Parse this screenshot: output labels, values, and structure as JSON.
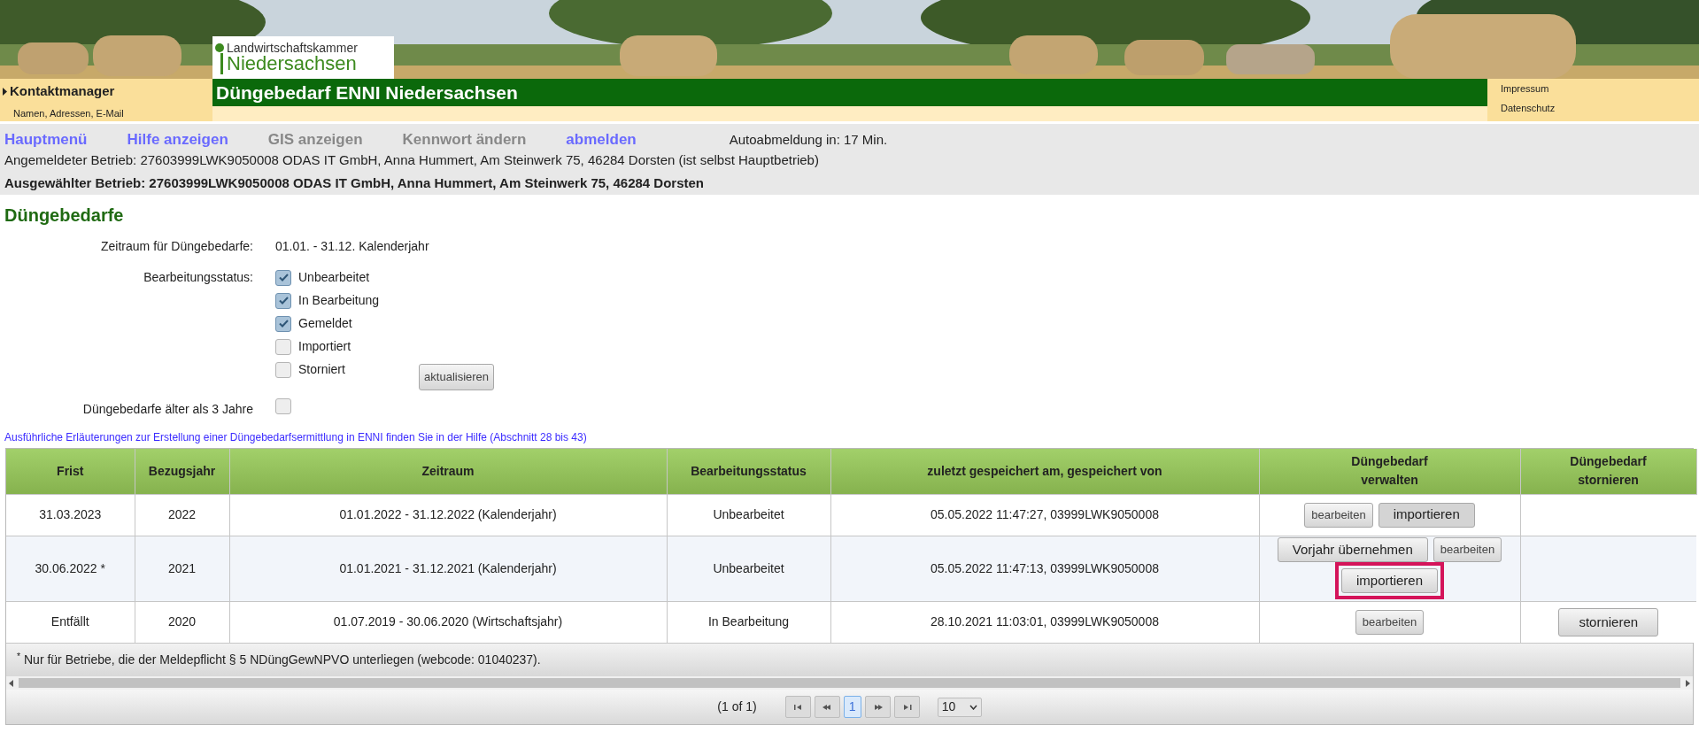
{
  "header": {
    "logo_line1": "Landwirtschaftskammer",
    "logo_line2": "Niedersachsen",
    "app_title": "Düngebedarf ENNI Niedersachsen",
    "contact_title": "Kontaktmanager",
    "contact_subtitle": "Namen, Adressen, E-Mail",
    "links": [
      "Impressum",
      "Datenschutz"
    ]
  },
  "nav": {
    "items": [
      {
        "label": "Hauptmenü",
        "disabled": false
      },
      {
        "label": "Hilfe anzeigen",
        "disabled": false
      },
      {
        "label": "GIS anzeigen",
        "disabled": true
      },
      {
        "label": "Kennwort ändern",
        "disabled": true
      },
      {
        "label": "abmelden",
        "disabled": false
      }
    ],
    "auto_logout": "Autoabmeldung in: 17 Min.",
    "logged_in": "Angemeldeter Betrieb: 27603999LWK9050008 ODAS IT GmbH, Anna Hummert, Am Steinwerk 75, 46284 Dorsten (ist selbst Hauptbetrieb)",
    "selected_company": "Ausgewählter Betrieb: 27603999LWK9050008 ODAS IT GmbH, Anna Hummert, Am Steinwerk 75, 46284 Dorsten"
  },
  "page_title": "Düngebedarfe",
  "filter": {
    "period_label": "Zeitraum für Düngebedarfe:",
    "period_value": "01.01. - 31.12. Kalenderjahr",
    "status_label": "Bearbeitungsstatus:",
    "statuses": [
      {
        "label": "Unbearbeitet",
        "checked": true
      },
      {
        "label": "In Bearbeitung",
        "checked": true
      },
      {
        "label": "Gemeldet",
        "checked": true
      },
      {
        "label": "Importiert",
        "checked": false
      },
      {
        "label": "Storniert",
        "checked": false
      }
    ],
    "refresh_button": "aktualisieren",
    "older_label": "Düngebedarfe älter als 3 Jahre",
    "older_checked": false
  },
  "help_link": "Ausführliche Erläuterungen zur Erstellung einer Düngebedarfsermittlung in ENNI finden Sie in der Hilfe (Abschnitt 28 bis 43)",
  "table": {
    "columns": [
      "Frist",
      "Bezugsjahr",
      "Zeitraum",
      "Bearbeitungsstatus",
      "zuletzt gespeichert am, gespeichert von",
      "Düngebedarf\nverwalten",
      "Düngebedarf\nstornieren"
    ],
    "rows": [
      {
        "cells": [
          "31.03.2023",
          "2022",
          "01.01.2022 - 31.12.2022 (Kalenderjahr)",
          "Unbearbeitet",
          "05.05.2022 11:47:27, 03999LWK9050008"
        ],
        "actions": [
          {
            "label": "bearbeiten",
            "kind": "small",
            "highlighted": false
          },
          {
            "label": "importieren",
            "kind": "dark",
            "highlighted": false
          }
        ],
        "cancel": []
      },
      {
        "cells": [
          "30.06.2022 *",
          "2021",
          "01.01.2021 - 31.12.2021 (Kalenderjahr)",
          "Unbearbeitet",
          "05.05.2022 11:47:13, 03999LWK9050008"
        ],
        "actions": [
          {
            "label": "Vorjahr übernehmen",
            "kind": "normal",
            "highlighted": false
          },
          {
            "label": "bearbeiten",
            "kind": "small",
            "highlighted": false
          },
          {
            "label": "importieren",
            "kind": "normal",
            "highlighted": true
          }
        ],
        "cancel": []
      },
      {
        "cells": [
          "Entfällt",
          "2020",
          "01.07.2019 - 30.06.2020 (Wirtschaftsjahr)",
          "In Bearbeitung",
          "28.10.2021 11:03:01, 03999LWK9050008"
        ],
        "actions": [
          {
            "label": "bearbeiten",
            "kind": "small",
            "highlighted": false
          }
        ],
        "cancel": [
          "stornieren"
        ]
      }
    ],
    "footnote_mark": "*",
    "footnote": "Nur für Betriebe, die der Meldepflicht § 5 NDüngGewNPVO unterliegen (webcode: 01040237)."
  },
  "pagination": {
    "info": "(1 of 1)",
    "pages": [
      {
        "label": "1",
        "selected": true
      }
    ],
    "page_size": "10"
  }
}
